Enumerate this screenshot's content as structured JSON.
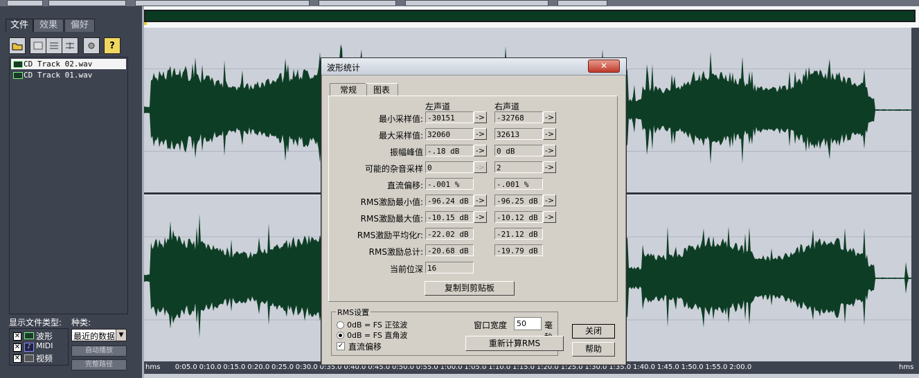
{
  "left_panel": {
    "tabs": [
      "文件",
      "效果",
      "偏好"
    ],
    "files": [
      "CD Track 02.wav",
      "CD Track 01.wav"
    ],
    "file_types_label": "显示文件类型:",
    "kind_label": "种类:",
    "file_types": [
      "波形",
      "MIDI",
      "视频"
    ],
    "kind_select": "最近的数据",
    "auto_play_button": "自动播放",
    "full_path_button": "完整路径"
  },
  "timeline": {
    "ticks": [
      "hms",
      "0:05.0",
      "0:10.0",
      "0:15.0",
      "0:20.0",
      "0:25.0",
      "0:30.0",
      "0:35.0",
      "0:40.0",
      "0:45.0",
      "0:50.0",
      "0:55.0",
      "1:00.0",
      "1:05.0",
      "1:10.0",
      "1:15.0",
      "1:20.0",
      "1:25.0",
      "1:30.0",
      "1:35.0",
      "1:40.0",
      "1:45.0",
      "1:50.0",
      "1:55.0",
      "2:00.0",
      "hms"
    ]
  },
  "dialog": {
    "title": "波形统计",
    "close_symbol": "✕",
    "tabs": {
      "general": "常规",
      "chart": "图表"
    },
    "left_channel": "左声道",
    "right_channel": "右声道",
    "rows": [
      {
        "label": "最小采样值:",
        "left": "-30151",
        "right": "-32768"
      },
      {
        "label": "最大采样值:",
        "left": "32060",
        "right": "32613"
      },
      {
        "label": "振幅峰值",
        "left": "-.18 dB",
        "right": "0 dB"
      },
      {
        "label": "可能的杂音采样",
        "left": "0",
        "right": "2"
      },
      {
        "label": "直流偏移:",
        "left": "-.001 %",
        "right": "-.001 %"
      },
      {
        "label": "RMS激励最小值:",
        "left": "-96.24 dB",
        "right": "-96.25 dB"
      },
      {
        "label": "RMS激励最大值:",
        "left": "-10.15 dB",
        "right": "-10.12 dB"
      },
      {
        "label": "RMS激励平均化r:",
        "left": "-22.02 dB",
        "right": "-21.12 dB"
      },
      {
        "label": "RMS激励总计:",
        "left": "-20.68 dB",
        "right": "-19.79 dB"
      }
    ],
    "bit_depth_label": "当前位深",
    "bit_depth_value": "16",
    "arrow": "->",
    "copy_button": "复制到剪贴板",
    "rms_settings": {
      "group_title": "RMS设置",
      "sine_option": "0dB = FS 正弦波",
      "square_option": "0dB = FS 直角波",
      "dc_offset": "直流偏移",
      "window_width_label": "窗口宽度",
      "window_width_value": "50",
      "window_width_unit": "毫秒",
      "recalc_button": "重新计算RMS"
    },
    "close_button": "关闭",
    "help_button": "帮助"
  },
  "colors": {
    "waveform": "#0e3d25",
    "panel": "#3e4350",
    "track_bg": "#ccd0d9",
    "dialog_bg": "#d4d0c8"
  }
}
